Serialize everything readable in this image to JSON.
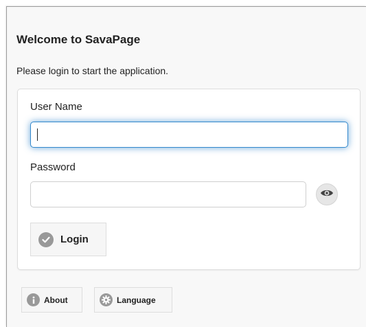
{
  "dialog": {
    "title": "Welcome to SavaPage",
    "intro": "Please login to start the application."
  },
  "form": {
    "username_label": "User Name",
    "username_value": "",
    "password_label": "Password",
    "password_value": "",
    "login_label": "Login"
  },
  "footer": {
    "about_label": "About",
    "language_label": "Language"
  },
  "icons": {
    "show_password": "eye-icon",
    "login": "check-icon",
    "about": "info-icon",
    "language": "gear-icon"
  },
  "colors": {
    "focus": "#3388cc",
    "icon_disc": "#999999"
  }
}
